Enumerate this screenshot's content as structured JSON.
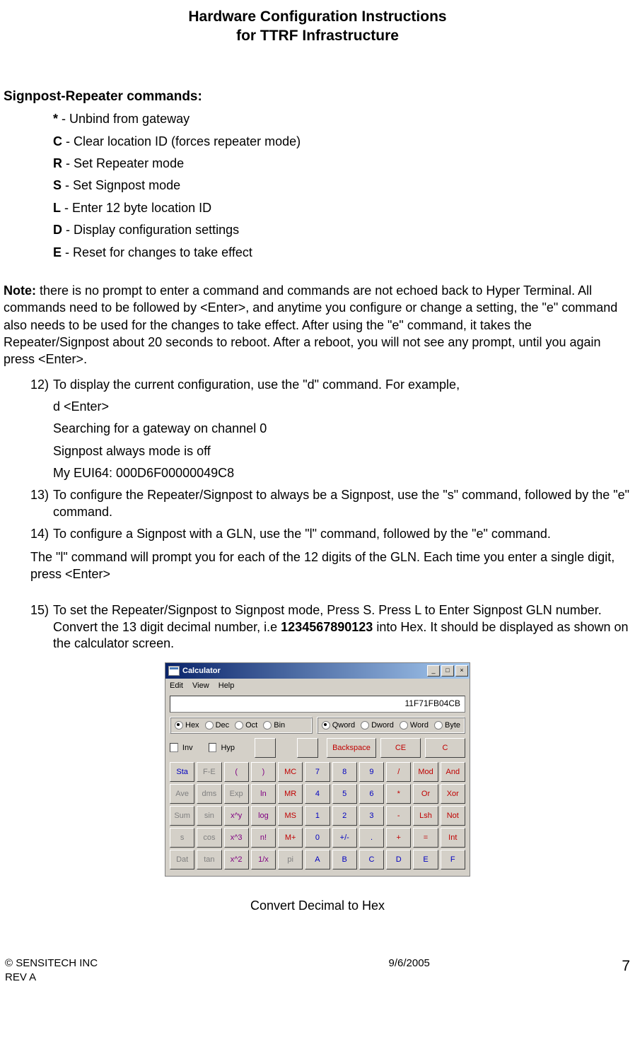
{
  "header": {
    "line1": "Hardware Configuration Instructions",
    "line2": "for TTRF Infrastructure"
  },
  "section_heading": "Signpost-Repeater commands:",
  "commands": [
    {
      "key": "*",
      "desc": " - Unbind from gateway"
    },
    {
      "key": "C",
      "desc": " - Clear location ID (forces repeater mode)"
    },
    {
      "key": "R",
      "desc": " - Set Repeater mode"
    },
    {
      "key": "S",
      "desc": " - Set Signpost mode"
    },
    {
      "key": "L",
      "desc": " - Enter 12 byte location ID"
    },
    {
      "key": "D",
      "desc": " - Display configuration settings"
    },
    {
      "key": "E",
      "desc": " - Reset for changes to take effect"
    }
  ],
  "note": {
    "label": "Note:",
    "body": "  there is no prompt to enter a command and commands are not echoed back to Hyper Terminal.  All commands need to be followed by <Enter>, and anytime you configure or change a setting, the \"e\" command also needs to be used for the changes to take effect. After using the \"e\" command, it takes the Repeater/Signpost about 20 seconds to reboot. After a reboot, you will not see any prompt, until you again press <Enter>."
  },
  "items": {
    "i12": {
      "num": "12)",
      "text": "To display the current configuration, use the \"d\" command.  For example,",
      "lines": [
        "d  <Enter>",
        "Searching for a gateway on channel 0",
        "Signpost always mode is off",
        "My EUI64: 000D6F00000049C8"
      ]
    },
    "i13": {
      "num": "13)",
      "text": "To configure the Repeater/Signpost to always be a Signpost, use the \"s\" command, followed by the \"e\" command."
    },
    "i14": {
      "num": "14)",
      "text": "To configure a Signpost with a GLN, use the \"l\" command, followed by the \"e\" command."
    },
    "i14_follow": "The \"l\" command will prompt you for each of the 12 digits of the GLN.  Each time you enter a single digit, press <Enter>",
    "i15": {
      "num": "15)",
      "text_a": "To set the Repeater/Signpost to Signpost mode, Press S. Press L to Enter Signpost GLN number. Convert the 13 digit decimal number, i.e ",
      "bold": "1234567890123",
      "text_b": " into Hex. It should be displayed as shown on the calculator screen."
    }
  },
  "calculator": {
    "title": "Calculator",
    "menu": {
      "edit": "Edit",
      "view": "View",
      "help": "Help"
    },
    "display": "11F71FB04CB",
    "base": {
      "hex": "Hex",
      "dec": "Dec",
      "oct": "Oct",
      "bin": "Bin",
      "selected": "hex"
    },
    "word": {
      "qword": "Qword",
      "dword": "Dword",
      "word": "Word",
      "byte": "Byte",
      "selected": "qword"
    },
    "inv": "Inv",
    "hyp": "Hyp",
    "backspace": "Backspace",
    "ce": "CE",
    "c": "C",
    "rows": [
      [
        "Sta",
        "F-E",
        "(",
        ")",
        "MC",
        "7",
        "8",
        "9",
        "/",
        "Mod",
        "And"
      ],
      [
        "Ave",
        "dms",
        "Exp",
        "ln",
        "MR",
        "4",
        "5",
        "6",
        "*",
        "Or",
        "Xor"
      ],
      [
        "Sum",
        "sin",
        "x^y",
        "log",
        "MS",
        "1",
        "2",
        "3",
        "-",
        "Lsh",
        "Not"
      ],
      [
        "s",
        "cos",
        "x^3",
        "n!",
        "M+",
        "0",
        "+/-",
        ".",
        "+",
        "=",
        "Int"
      ],
      [
        "Dat",
        "tan",
        "x^2",
        "1/x",
        "pi",
        "A",
        "B",
        "C",
        "D",
        "E",
        "F"
      ]
    ],
    "win": {
      "min": "_",
      "max": "□",
      "close": "×"
    }
  },
  "caption": "Convert Decimal to Hex",
  "footer": {
    "copyright": "© SENSITECH INC",
    "rev": "REV A",
    "date": "9/6/2005",
    "page": "7"
  }
}
